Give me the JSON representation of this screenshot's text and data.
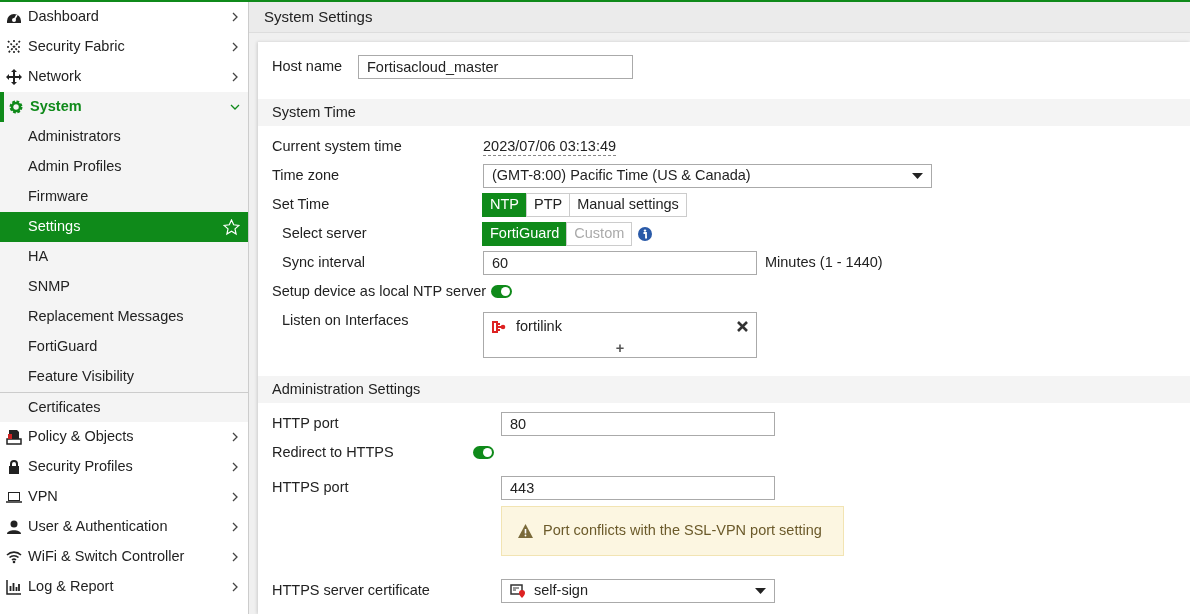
{
  "sidebar": {
    "items": [
      {
        "label": "Dashboard",
        "expanded": false
      },
      {
        "label": "Security Fabric",
        "expanded": false
      },
      {
        "label": "Network",
        "expanded": false
      },
      {
        "label": "System",
        "expanded": true,
        "children": [
          {
            "label": "Administrators",
            "selected": false
          },
          {
            "label": "Admin Profiles",
            "selected": false
          },
          {
            "label": "Firmware",
            "selected": false
          },
          {
            "label": "Settings",
            "selected": true
          },
          {
            "label": "HA",
            "selected": false
          },
          {
            "label": "SNMP",
            "selected": false
          },
          {
            "label": "Replacement Messages",
            "selected": false
          },
          {
            "label": "FortiGuard",
            "selected": false
          },
          {
            "label": "Feature Visibility",
            "selected": false
          },
          {
            "label": "Certificates",
            "selected": false
          }
        ]
      },
      {
        "label": "Policy & Objects",
        "expanded": false
      },
      {
        "label": "Security Profiles",
        "expanded": false
      },
      {
        "label": "VPN",
        "expanded": false
      },
      {
        "label": "User & Authentication",
        "expanded": false
      },
      {
        "label": "WiFi & Switch Controller",
        "expanded": false
      },
      {
        "label": "Log & Report",
        "expanded": false
      }
    ]
  },
  "page_title": "System Settings",
  "host_name": {
    "label": "Host name",
    "value": "Fortisacloud_master"
  },
  "sections": [
    {
      "title": "System Time",
      "rows": [
        {
          "kind": "text",
          "label": "Current system time",
          "value": "2023/07/06 03:13:49"
        },
        {
          "kind": "select",
          "label": "Time zone",
          "value": "(GMT-8:00) Pacific Time (US & Canada)"
        },
        {
          "kind": "segmented",
          "label": "Set Time",
          "options": [
            {
              "label": "NTP",
              "selected": true,
              "disabled": false
            },
            {
              "label": "PTP",
              "selected": false,
              "disabled": false
            },
            {
              "label": "Manual settings",
              "selected": false,
              "disabled": false
            }
          ],
          "children": [
            {
              "kind": "segmented",
              "label": "Select server",
              "options": [
                {
                  "label": "FortiGuard",
                  "selected": true,
                  "disabled": false
                },
                {
                  "label": "Custom",
                  "selected": false,
                  "disabled": true
                }
              ]
            },
            {
              "kind": "input",
              "label": "Sync interval",
              "value": "60",
              "suffix": "Minutes (1 - 1440)"
            }
          ]
        },
        {
          "kind": "toggle",
          "label": "Setup device as local NTP server",
          "on": true,
          "children": [
            {
              "kind": "interfaces",
              "label": "Listen on Interfaces",
              "items": [
                "fortilink"
              ],
              "add": "+"
            }
          ]
        }
      ]
    },
    {
      "title": "Administration Settings",
      "rows": [
        {
          "kind": "input",
          "label": "HTTP port",
          "value": "80"
        },
        {
          "kind": "toggle",
          "label": "Redirect to HTTPS",
          "on": true
        },
        {
          "kind": "input",
          "label": "HTTPS port",
          "value": "443"
        },
        {
          "kind": "warning",
          "text": "Port conflicts with the SSL-VPN port setting"
        },
        {
          "kind": "select",
          "label": "HTTPS server certificate",
          "value": "self-sign"
        }
      ]
    }
  ]
}
